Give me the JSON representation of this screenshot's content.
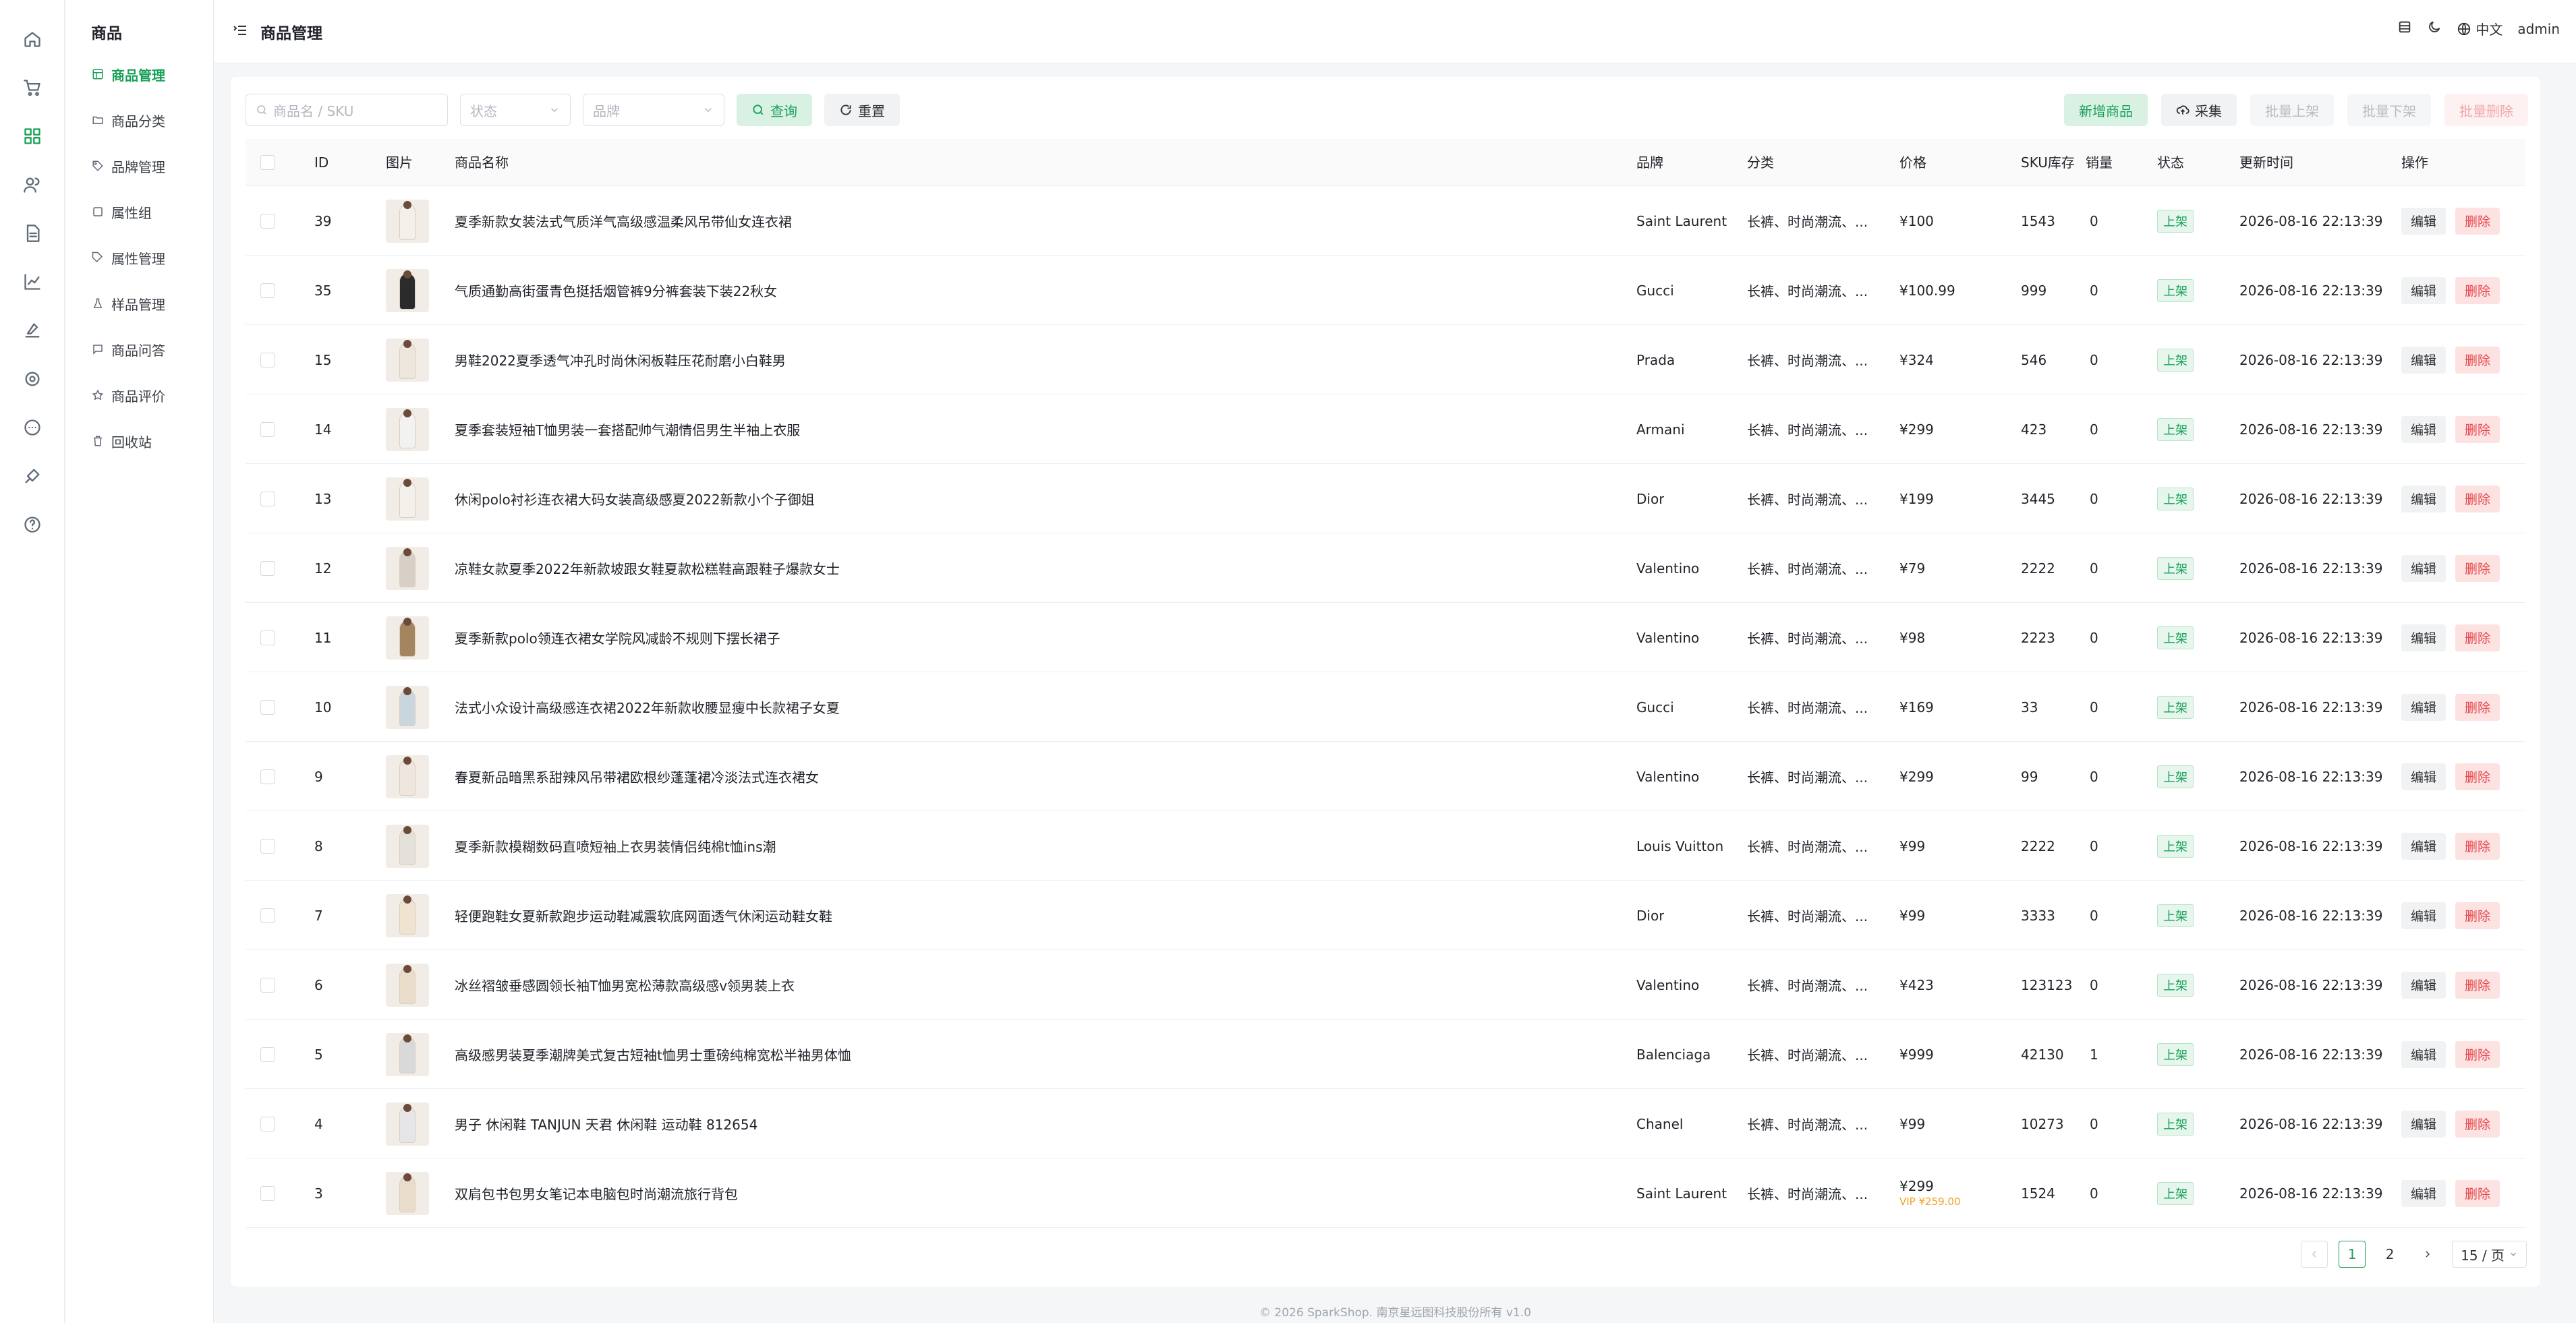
{
  "sidebar": {
    "title": "商品",
    "items": [
      {
        "label": "商品管理",
        "icon": "grid-icon",
        "active": true
      },
      {
        "label": "商品分类",
        "icon": "folder-icon"
      },
      {
        "label": "品牌管理",
        "icon": "tag-icon"
      },
      {
        "label": "属性组",
        "icon": "box-icon"
      },
      {
        "label": "属性管理",
        "icon": "price-tag-icon"
      },
      {
        "label": "样品管理",
        "icon": "flask-icon"
      },
      {
        "label": "商品问答",
        "icon": "chat-icon"
      },
      {
        "label": "商品评价",
        "icon": "star-icon"
      },
      {
        "label": "回收站",
        "icon": "trash-icon"
      }
    ]
  },
  "header": {
    "title": "商品管理",
    "lang": "中文",
    "user": "admin"
  },
  "toolbar": {
    "search_placeholder": "商品名 / SKU",
    "status_placeholder": "状态",
    "brand_placeholder": "品牌",
    "query_label": "查询",
    "reset_label": "重置",
    "add_label": "新增商品",
    "collect_label": "采集",
    "batch_on_label": "批量上架",
    "batch_off_label": "批量下架",
    "batch_delete_label": "批量删除"
  },
  "table": {
    "columns": [
      "ID",
      "图片",
      "商品名称",
      "品牌",
      "分类",
      "价格",
      "SKU库存",
      "销量",
      "状态",
      "更新时间",
      "操作"
    ],
    "edit_label": "编辑",
    "delete_label": "删除",
    "rows": [
      {
        "id": "39",
        "name": "夏季新款女装法式气质洋气高级感温柔风吊带仙女连衣裙",
        "brand": "Saint Laurent",
        "category": "长裤、时尚潮流、...",
        "price": "¥100",
        "stock": "1543",
        "sales": "0",
        "status": "上架",
        "updated": "2026-08-16 22:13:39"
      },
      {
        "id": "35",
        "name": "气质通勤高街蛋青色挺括烟管裤9分裤套装下装22秋女",
        "brand": "Gucci",
        "category": "长裤、时尚潮流、...",
        "price": "¥100.99",
        "stock": "999",
        "sales": "0",
        "status": "上架",
        "updated": "2026-08-16 22:13:39"
      },
      {
        "id": "15",
        "name": "男鞋2022夏季透气冲孔时尚休闲板鞋压花耐磨小白鞋男",
        "brand": "Prada",
        "category": "长裤、时尚潮流、...",
        "price": "¥324",
        "stock": "546",
        "sales": "0",
        "status": "上架",
        "updated": "2026-08-16 22:13:39"
      },
      {
        "id": "14",
        "name": "夏季套装短袖T恤男装一套搭配帅气潮情侣男生半袖上衣服",
        "brand": "Armani",
        "category": "长裤、时尚潮流、...",
        "price": "¥299",
        "stock": "423",
        "sales": "0",
        "status": "上架",
        "updated": "2026-08-16 22:13:39"
      },
      {
        "id": "13",
        "name": "休闲polo衬衫连衣裙大码女装高级感夏2022新款小个子御姐",
        "brand": "Dior",
        "category": "长裤、时尚潮流、...",
        "price": "¥199",
        "stock": "3445",
        "sales": "0",
        "status": "上架",
        "updated": "2026-08-16 22:13:39"
      },
      {
        "id": "12",
        "name": "凉鞋女款夏季2022年新款坡跟女鞋夏款松糕鞋高跟鞋子爆款女士",
        "brand": "Valentino",
        "category": "长裤、时尚潮流、...",
        "price": "¥79",
        "stock": "2222",
        "sales": "0",
        "status": "上架",
        "updated": "2026-08-16 22:13:39"
      },
      {
        "id": "11",
        "name": "夏季新款polo领连衣裙女学院风减龄不规则下摆长裙子",
        "brand": "Valentino",
        "category": "长裤、时尚潮流、...",
        "price": "¥98",
        "stock": "2223",
        "sales": "0",
        "status": "上架",
        "updated": "2026-08-16 22:13:39"
      },
      {
        "id": "10",
        "name": "法式小众设计高级感连衣裙2022年新款收腰显瘦中长款裙子女夏",
        "brand": "Gucci",
        "category": "长裤、时尚潮流、...",
        "price": "¥169",
        "stock": "33",
        "sales": "0",
        "status": "上架",
        "updated": "2026-08-16 22:13:39"
      },
      {
        "id": "9",
        "name": "春夏新品暗黑系甜辣风吊带裙欧根纱蓬蓬裙冷淡法式连衣裙女",
        "brand": "Valentino",
        "category": "长裤、时尚潮流、...",
        "price": "¥299",
        "stock": "99",
        "sales": "0",
        "status": "上架",
        "updated": "2026-08-16 22:13:39"
      },
      {
        "id": "8",
        "name": "夏季新款模糊数码直喷短袖上衣男装情侣纯棉t恤ins潮",
        "brand": "Louis Vuitton",
        "category": "长裤、时尚潮流、...",
        "price": "¥99",
        "stock": "2222",
        "sales": "0",
        "status": "上架",
        "updated": "2026-08-16 22:13:39"
      },
      {
        "id": "7",
        "name": "轻便跑鞋女夏新款跑步运动鞋减震软底网面透气休闲运动鞋女鞋",
        "brand": "Dior",
        "category": "长裤、时尚潮流、...",
        "price": "¥99",
        "stock": "3333",
        "sales": "0",
        "status": "上架",
        "updated": "2026-08-16 22:13:39"
      },
      {
        "id": "6",
        "name": "冰丝褶皱垂感圆领长袖T恤男宽松薄款高级感v领男装上衣",
        "brand": "Valentino",
        "category": "长裤、时尚潮流、...",
        "price": "¥423",
        "stock": "123123",
        "sales": "0",
        "status": "上架",
        "updated": "2026-08-16 22:13:39"
      },
      {
        "id": "5",
        "name": "高级感男装夏季潮牌美式复古短袖t恤男士重磅纯棉宽松半袖男体恤",
        "brand": "Balenciaga",
        "category": "长裤、时尚潮流、...",
        "price": "¥999",
        "stock": "42130",
        "sales": "1",
        "status": "上架",
        "updated": "2026-08-16 22:13:39"
      },
      {
        "id": "4",
        "name": "男子 休闲鞋 TANJUN 天君 休闲鞋 运动鞋 812654",
        "brand": "Chanel",
        "category": "长裤、时尚潮流、...",
        "price": "¥99",
        "stock": "10273",
        "sales": "0",
        "status": "上架",
        "updated": "2026-08-16 22:13:39"
      },
      {
        "id": "3",
        "name": "双肩包书包男女笔记本电脑包时尚潮流旅行背包",
        "brand": "Saint Laurent",
        "category": "长裤、时尚潮流、...",
        "price": "¥299",
        "vip_price": "VIP ¥259.00",
        "stock": "1524",
        "sales": "0",
        "status": "上架",
        "updated": "2026-08-16 22:13:39"
      }
    ]
  },
  "pagination": {
    "pages": [
      "1",
      "2"
    ],
    "current": "1",
    "page_size": "15 / 页"
  },
  "footer": "© 2026 SparkShop. 南京星远图科技股份所有    v1.0",
  "colors": {
    "accent": "#18a058",
    "danger": "#e5484d",
    "vip": "#f0a020"
  },
  "thumb_colors": [
    "#f3efe9",
    "#2b2b2b",
    "#ece6dc",
    "#f2f2f0",
    "#f4f1ed",
    "#d8cfc6",
    "#a58560",
    "#c9d6de",
    "#efe7df",
    "#e4e1da",
    "#eee4cf",
    "#e9dcc8",
    "#d9d9d9",
    "#e6e6e8",
    "#e8dccb"
  ]
}
